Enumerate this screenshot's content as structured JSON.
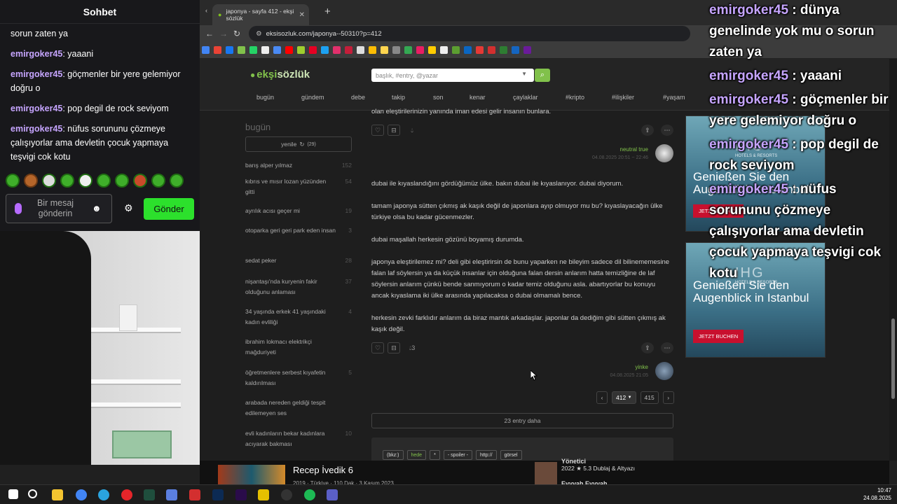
{
  "chat": {
    "title": "Sohbet",
    "messages": [
      {
        "user": "",
        "text": "sorun zaten ya"
      },
      {
        "user": "emirgoker45",
        "text": ": yaaani"
      },
      {
        "user": "emirgoker45",
        "text": ": göçmenler bir yere gelemiyor doğru o"
      },
      {
        "user": "emirgoker45",
        "text": ": pop degil de rock seviyom"
      },
      {
        "user": "emirgoker45",
        "text": ": nüfus sorununu çözmeye çalışıyorlar ama devletin çocuk yapmaya teşvigi cok kotu"
      }
    ],
    "input_placeholder": "Bir mesaj gönderin",
    "send_label": "Gönder"
  },
  "overlay": [
    {
      "user": "emirgoker45",
      "text": " : dünya genelinde yok mu o sorun zaten ya"
    },
    {
      "user": "emirgoker45",
      "text": " : yaaani"
    },
    {
      "user": "emirgoker45",
      "text": " : göçmenler bir yere gelemiyor doğru o"
    },
    {
      "user": "emirgoker45",
      "text": " : pop degil de rock seviyom"
    },
    {
      "user": "emirgoker45",
      "text": " : nüfus sorununu çözmeye çalışıyorlar ama devletin çocuk yapmaya teşvigi cok kotu"
    }
  ],
  "browser": {
    "tab_title": "japonya - sayfa 412 - ekşi sözlük",
    "url": "eksisozluk.com/japonya--50310?p=412"
  },
  "site": {
    "logo_main": "ekşi",
    "logo_sub": "sözlük",
    "search_placeholder": "başlık, #entry, @yazar",
    "nav": [
      "bugün",
      "gündem",
      "debe",
      "takip",
      "son",
      "kenar",
      "çaylaklar",
      "#kripto",
      "#ilişkiler",
      "#yaşam"
    ],
    "left_title": "bugün",
    "refresh_label": "yenile",
    "refresh_count": "(29)",
    "left_items": [
      {
        "title": "barış alper yılmaz",
        "count": "152"
      },
      {
        "title": "kıbrıs ve mısır lozan yüzünden gitti",
        "count": "54"
      },
      {
        "title": "ayrılık acısı geçer mi",
        "count": "19"
      },
      {
        "title": "otoparka geri geri park eden insan",
        "count": "3"
      },
      {
        "title": "sedat peker",
        "count": "28"
      },
      {
        "title": "nişantaşı'nda kuryenin fakir olduğunu anlaması",
        "count": "37"
      },
      {
        "title": "34 yaşında erkek 41 yaşındaki kadın evliliği",
        "count": "4"
      },
      {
        "title": "ibrahim lokmacı elektrikçi mağduriyeti",
        "count": ""
      },
      {
        "title": "öğretmenlere serbest kıyafetin kaldırılması",
        "count": "5"
      },
      {
        "title": "arabada nereden geldiği tespit edilemeyen ses",
        "count": ""
      },
      {
        "title": "evli kadınların bekar kadınlara acıyarak bakması",
        "count": "10"
      }
    ],
    "entry1_tail": "olan eleştirilerinizin yanında iman edesi gelir insanın bunlara.",
    "entry1_author": "neutral true",
    "entry1_date": "04.08.2025 20:51 ~ 22:46",
    "entry2_paragraphs": [
      "dubai ile kıyaslandığını gördüğümüz ülke. bakın dubai ile kıyaslanıyor. dubai diyorum.",
      "tamam japonya sütten çıkmış ak kaşık değil de japonlara ayıp olmuyor mu bu? kıyaslayacağın ülke türkiye olsa bu kadar gücenmezler.",
      "dubai maşallah herkesin gözünü boyamış durumda.",
      "japonya eleştirilemez mi? deli gibi eleştirirsin de bunu yaparken ne bileyim sadece dil bilinememesine falan laf söylersin ya da küçük insanlar için olduğuna falan dersin anlarım hatta temizliğine de laf söylersin anlarım çünkü bende sanmıyorum o kadar temiz olduğunu asla. abartıyorlar bu konuyu ancak kıyaslama iki ülke arasında yapılacaksa o dubai olmamalı bence.",
      "herkesin zevki farklıdır anlarım da biraz mantık arkadaşlar. japonlar da dediğim gibi sütten çıkmış ak kaşık değil."
    ],
    "entry2_favs": "3",
    "entry2_author": "yinke",
    "entry2_date": "04.08.2025 21:05",
    "pager_current": "412",
    "pager_total": "415",
    "more_entries": "23 entry daha",
    "editor_buttons": [
      "(bkz:)",
      "hede",
      "*",
      "- spoiler -",
      "http://",
      "görsel"
    ]
  },
  "ads": [
    {
      "brand": "IHG",
      "sub": "HOTELS & RESORTS",
      "headline": "Genießen Sie den Augenblick in Istanbul",
      "cta": "JETZT BUCHEN"
    },
    {
      "brand": "IHG",
      "sub": "HOTELS & RESORTS",
      "headline": "Genießen Sie den Augenblick in Istanbul",
      "cta": "JETZT BUCHEN"
    }
  ],
  "media": {
    "title": "Recep İvedik 6",
    "meta": "2019 · Türkiye · 110 Dak · 3 Kasım 2023",
    "right_top": "Yönetici",
    "right_line1": "2022  ★ 5.3  Dublaj & Altyazı",
    "right_line2": "Evyvah Evyvah"
  },
  "clock": {
    "time": "10:47",
    "date": "24.08.2025"
  }
}
